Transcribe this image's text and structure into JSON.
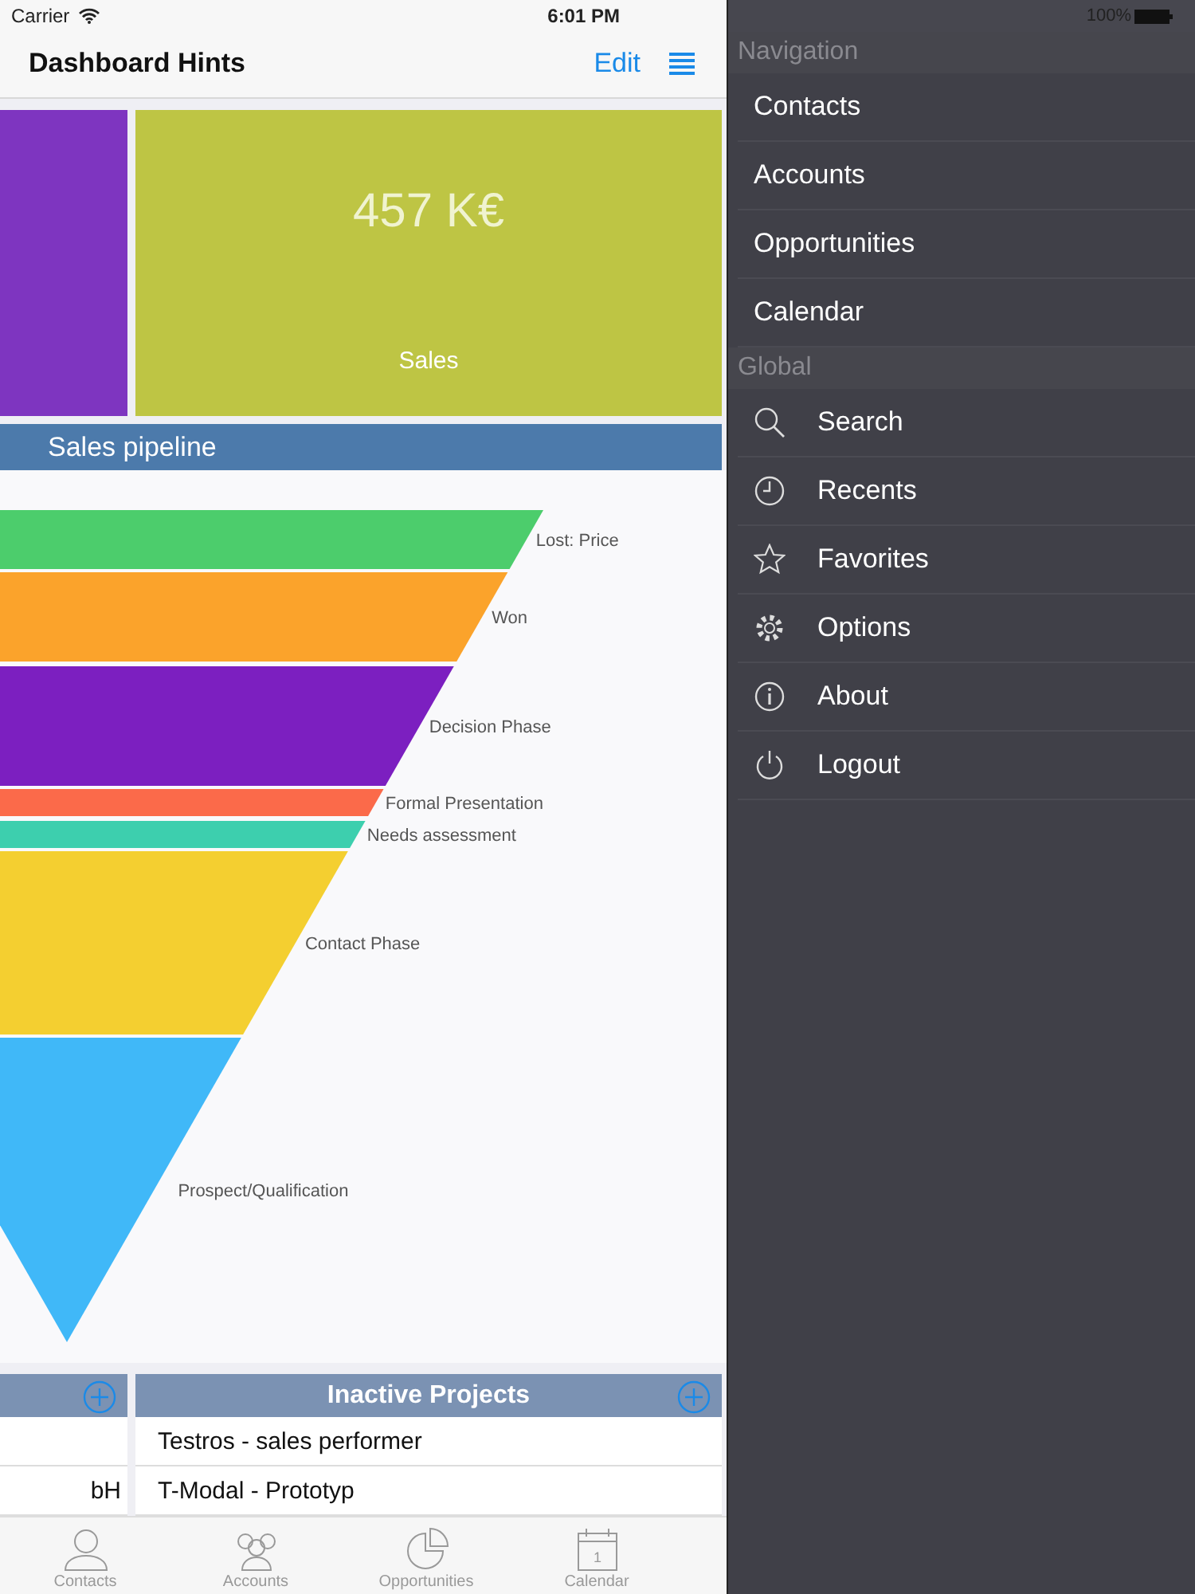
{
  "status_bar": {
    "carrier": "Carrier",
    "time": "6:01 PM",
    "battery": "100%"
  },
  "nav_bar": {
    "title": "Dashboard Hints",
    "edit": "Edit"
  },
  "tiles": [
    {
      "color": "#7e35c0"
    },
    {
      "value": "457 K€",
      "label": "Sales",
      "color": "#bec544"
    }
  ],
  "pipeline": {
    "title": "Sales pipeline",
    "stages": [
      {
        "label": "Lost: Price",
        "color": "#4ccd6c"
      },
      {
        "label": "Won",
        "color": "#fba32b"
      },
      {
        "label": "Decision Phase",
        "color": "#7c1fc0"
      },
      {
        "label": "Formal Presentation",
        "color": "#fb6a4a"
      },
      {
        "label": "Needs assessment",
        "color": "#3dcfae"
      },
      {
        "label": "Contact Phase",
        "color": "#f4cf30"
      },
      {
        "label": "Prospect/Qualification",
        "color": "#40b8f8"
      }
    ]
  },
  "lists": [
    {
      "rows": [
        "bH"
      ]
    },
    {
      "title": "Inactive Projects",
      "rows": [
        "Testros - sales performer",
        "T-Modal - Prototyp"
      ]
    }
  ],
  "tabs": [
    {
      "label": "Contacts",
      "kind": "person",
      "selected": false
    },
    {
      "label": "Accounts",
      "kind": "people",
      "selected": false
    },
    {
      "label": "Opportunities",
      "kind": "pie",
      "selected": false
    },
    {
      "label": "Calendar",
      "kind": "calendar",
      "selected": false,
      "day": "1"
    }
  ],
  "menu": [
    {
      "title": "Navigation",
      "items": [
        {
          "label": "Contacts"
        },
        {
          "label": "Accounts"
        },
        {
          "label": "Opportunities"
        },
        {
          "label": "Calendar"
        }
      ]
    },
    {
      "title": "Global",
      "items": [
        {
          "label": "Search",
          "kind": "search"
        },
        {
          "label": "Recents",
          "kind": "clock"
        },
        {
          "label": "Favorites",
          "kind": "star"
        },
        {
          "label": "Options",
          "kind": "gear"
        },
        {
          "label": "About",
          "kind": "info"
        },
        {
          "label": "Logout",
          "kind": "power"
        }
      ]
    }
  ]
}
